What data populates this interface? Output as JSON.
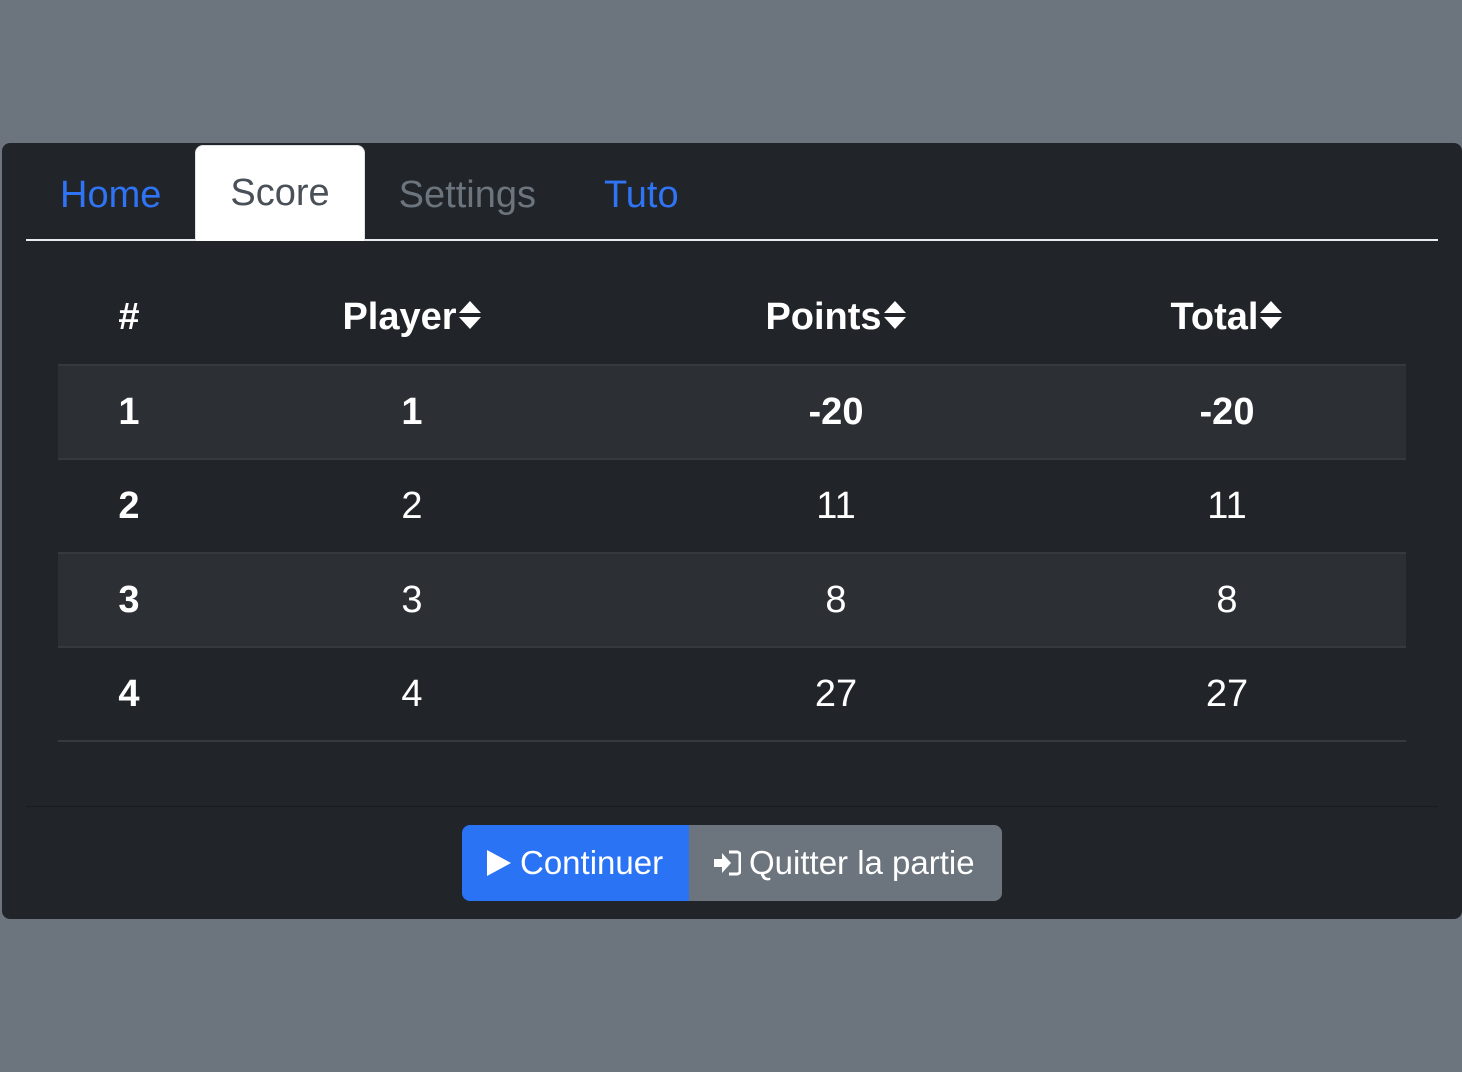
{
  "tabs": [
    {
      "label": "Home",
      "state": "link"
    },
    {
      "label": "Score",
      "state": "active"
    },
    {
      "label": "Settings",
      "state": "disabled"
    },
    {
      "label": "Tuto",
      "state": "link"
    }
  ],
  "table": {
    "headers": {
      "rank": "#",
      "player": "Player",
      "points": "Points",
      "total": "Total"
    },
    "rows": [
      {
        "rank": "1",
        "player": "1",
        "points": "-20",
        "total": "-20"
      },
      {
        "rank": "2",
        "player": "2",
        "points": "11",
        "total": "11"
      },
      {
        "rank": "3",
        "player": "3",
        "points": "8",
        "total": "8"
      },
      {
        "rank": "4",
        "player": "4",
        "points": "27",
        "total": "27"
      }
    ]
  },
  "buttons": {
    "continue_label": "Continuer",
    "continue_icon": "play-icon",
    "quit_label": "Quitter la partie",
    "quit_icon": "sign-in-icon"
  },
  "colors": {
    "backdrop": "#6c757d",
    "modal_bg": "#212529",
    "primary": "#2a73f5",
    "secondary": "#6c757d"
  }
}
